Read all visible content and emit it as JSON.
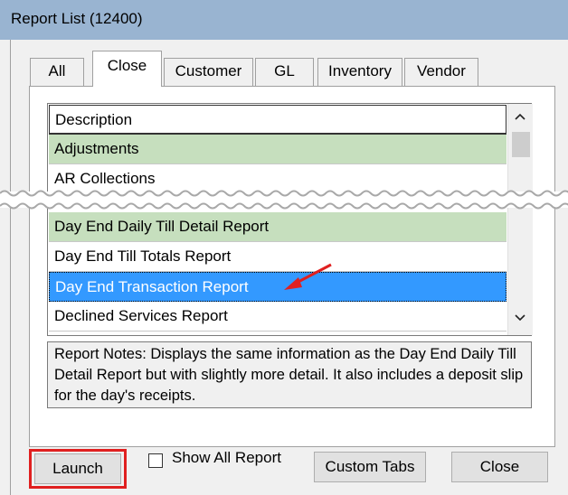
{
  "window": {
    "title": "Report List (12400)"
  },
  "tabs": [
    {
      "label": "All",
      "active": false
    },
    {
      "label": "Close",
      "active": true
    },
    {
      "label": "Customer",
      "active": false
    },
    {
      "label": "GL",
      "active": false
    },
    {
      "label": "Inventory",
      "active": false
    },
    {
      "label": "Vendor",
      "active": false
    }
  ],
  "list": {
    "header": "Description",
    "top_rows": [
      {
        "label": "Adjustments",
        "style": "green"
      },
      {
        "label": "AR Collections",
        "style": "plain"
      }
    ],
    "bottom_rows": [
      {
        "label": "Day End Daily Till Detail Report",
        "style": "green"
      },
      {
        "label": "Day End Till Totals Report",
        "style": "plain"
      },
      {
        "label": "Day End Transaction Report",
        "style": "selected"
      },
      {
        "label": "Declined Services Report",
        "style": "plain"
      }
    ]
  },
  "notes": {
    "text": "Report Notes:  Displays the same information as the Day End Daily Till Detail Report but with slightly more detail. It also includes a deposit slip for the day's receipts."
  },
  "buttons": {
    "launch": "Launch",
    "show_all": "Show All Report",
    "custom_tabs": "Custom Tabs",
    "close": "Close"
  },
  "show_all_checked": false,
  "colors": {
    "title_bar": "#99b4d1",
    "green_row": "#c6dfbe",
    "selected_row": "#3399ff",
    "highlight_red": "#e02020"
  }
}
